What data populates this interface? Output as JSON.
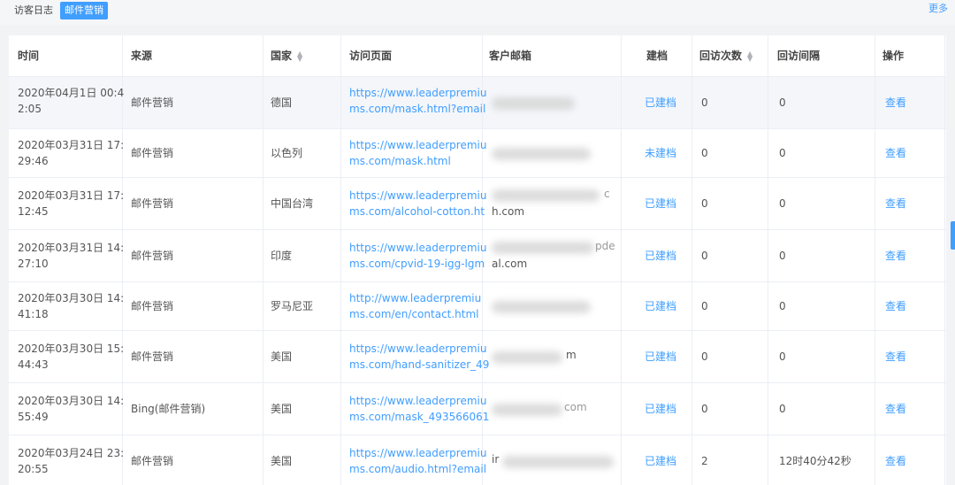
{
  "tabs": {
    "visitor_log": "访客日志",
    "email_marketing": "邮件营销"
  },
  "more_label": "更多",
  "columns": {
    "time": "时间",
    "source": "来源",
    "country": "国家",
    "page": "访问页面",
    "email": "客户邮箱",
    "archive": "建档",
    "revisit_count": "回访次数",
    "revisit_interval": "回访间隔",
    "action": "操作"
  },
  "rows": [
    {
      "time_l1": "2020年04月1日 00:4",
      "time_l2": "2:05",
      "source": "邮件营销",
      "country": "德国",
      "page_l1": "https://www.leaderpremiu",
      "page_l2": "ms.com/mask.html?email",
      "email_l1": "",
      "email_l2": "",
      "archive": "已建档",
      "count": "0",
      "interval": "0",
      "action": "查看"
    },
    {
      "time_l1": "2020年03月31日 17:",
      "time_l2": "29:46",
      "source": "邮件营销",
      "country": "以色列",
      "page_l1": "https://www.leaderpremiu",
      "page_l2": "ms.com/mask.html",
      "email_l1": "",
      "email_l2": "",
      "archive": "未建档",
      "count": "0",
      "interval": "0",
      "action": "查看"
    },
    {
      "time_l1": "2020年03月31日 17:",
      "time_l2": "12:45",
      "source": "邮件营销",
      "country": "中国台湾",
      "page_l1": "https://www.leaderpremiu",
      "page_l2": "ms.com/alcohol-cotton.ht",
      "email_l1": "c",
      "email_l2": "h.com",
      "archive": "已建档",
      "count": "0",
      "interval": "0",
      "action": "查看"
    },
    {
      "time_l1": "2020年03月31日 14:",
      "time_l2": "27:10",
      "source": "邮件营销",
      "country": "印度",
      "page_l1": "https://www.leaderpremiu",
      "page_l2": "ms.com/cpvid-19-igg-lgm",
      "email_l1": "pde",
      "email_l2": "al.com",
      "archive": "已建档",
      "count": "0",
      "interval": "0",
      "action": "查看"
    },
    {
      "time_l1": "2020年03月30日 14:",
      "time_l2": "41:18",
      "source": "邮件营销",
      "country": "罗马尼亚",
      "page_l1": "http://www.leaderpremiu",
      "page_l2": "ms.com/en/contact.html",
      "email_l1": "",
      "email_l2": "",
      "archive": "已建档",
      "count": "0",
      "interval": "0",
      "action": "查看"
    },
    {
      "time_l1": "2020年03月30日 15:",
      "time_l2": "44:43",
      "source": "邮件营销",
      "country": "美国",
      "page_l1": "https://www.leaderpremiu",
      "page_l2": "ms.com/hand-sanitizer_49",
      "email_l1": "m",
      "email_l2": "",
      "archive": "已建档",
      "count": "0",
      "interval": "0",
      "action": "查看"
    },
    {
      "time_l1": "2020年03月30日 14:",
      "time_l2": "55:49",
      "source": "Bing(邮件营销)",
      "country": "美国",
      "page_l1": "https://www.leaderpremiu",
      "page_l2": "ms.com/mask_493566061",
      "email_l1": "com",
      "email_l2": "",
      "archive": "已建档",
      "count": "0",
      "interval": "0",
      "action": "查看"
    },
    {
      "time_l1": "2020年03月24日 23:",
      "time_l2": "20:55",
      "source": "邮件营销",
      "country": "美国",
      "page_l1": "https://www.leaderpremiu",
      "page_l2": "ms.com/audio.html?email",
      "email_l1": "ir",
      "email_l2": "",
      "archive": "已建档",
      "count": "2",
      "interval": "12时40分42秒",
      "action": "查看"
    }
  ],
  "colors": {
    "accent": "#409eff",
    "row_highlight": "#f4f6fa"
  }
}
